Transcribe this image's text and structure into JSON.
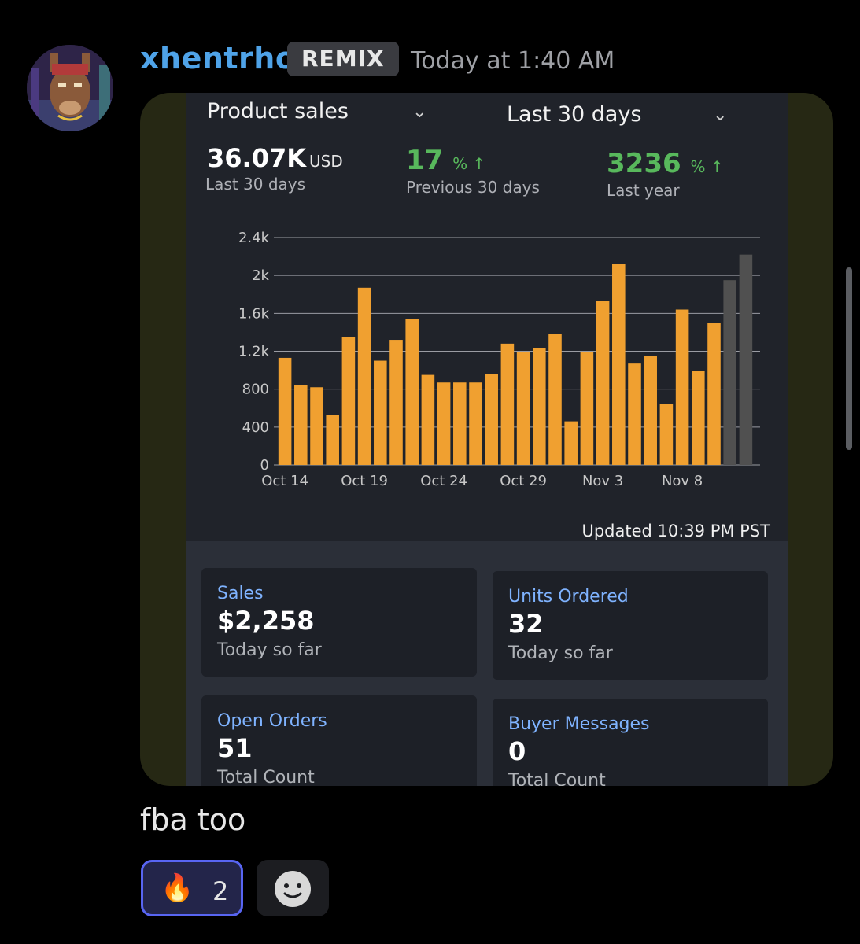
{
  "message": {
    "username": "xhentrho",
    "badge": "REMIX",
    "timestamp": "Today at 1:40 AM",
    "text": "fba too"
  },
  "reactions": [
    {
      "emoji": "🔥",
      "count": "2",
      "selected": true
    }
  ],
  "icons": {
    "add_reaction": "smiley-icon",
    "avatar": "llama-avatar"
  },
  "screenshot": {
    "metric_select": "Product sales",
    "range_select": "Last 30 days",
    "summary": [
      {
        "value": "36.07K",
        "unit": "USD",
        "label": "Last 30 days"
      },
      {
        "value": "17",
        "unit": "% ↑",
        "label": "Previous 30 days"
      },
      {
        "value": "3236",
        "unit": "% ↑",
        "label": "Last year"
      }
    ],
    "updated": "Updated 10:39 PM PST",
    "cards": [
      {
        "title": "Sales",
        "value": "$2,258",
        "note": "Today so far"
      },
      {
        "title": "Units Ordered",
        "value": "32",
        "note": "Today so far"
      },
      {
        "title": "Open Orders",
        "value": "51",
        "note": "Total Count"
      },
      {
        "title": "Buyer Messages",
        "value": "0",
        "note": "Total Count"
      }
    ],
    "colors": {
      "bar": "#f0a030",
      "bar_comparison": "#505050",
      "accent_green": "#58b85c",
      "link_blue": "#7fb3ff"
    }
  },
  "chart_data": {
    "type": "bar",
    "title": "",
    "xlabel": "",
    "ylabel": "",
    "ylim": [
      0,
      2400
    ],
    "yticks": [
      0,
      400,
      800,
      1200,
      1600,
      2000,
      2400
    ],
    "ytick_labels": [
      "0",
      "400",
      "800",
      "1.2k",
      "1.6k",
      "2k",
      "2.4k"
    ],
    "xtick_labels": [
      "Oct 14",
      "Oct 19",
      "Oct 24",
      "Oct 29",
      "Nov 3",
      "Nov 8"
    ],
    "grid": true,
    "series": [
      {
        "values": [
          1130,
          840,
          820,
          530,
          1350,
          1870,
          1100,
          1320,
          1540,
          950,
          870,
          870,
          870,
          960,
          1280,
          1190,
          1230,
          1380,
          460,
          1190,
          1730,
          2120,
          1070,
          1150,
          640,
          1640,
          990,
          1500,
          1950,
          2220
        ]
      }
    ],
    "bar_colors": [
      "o",
      "o",
      "o",
      "o",
      "o",
      "o",
      "o",
      "o",
      "o",
      "o",
      "o",
      "o",
      "o",
      "o",
      "o",
      "o",
      "o",
      "o",
      "o",
      "o",
      "o",
      "o",
      "o",
      "o",
      "o",
      "o",
      "o",
      "o",
      "g",
      "g"
    ]
  }
}
